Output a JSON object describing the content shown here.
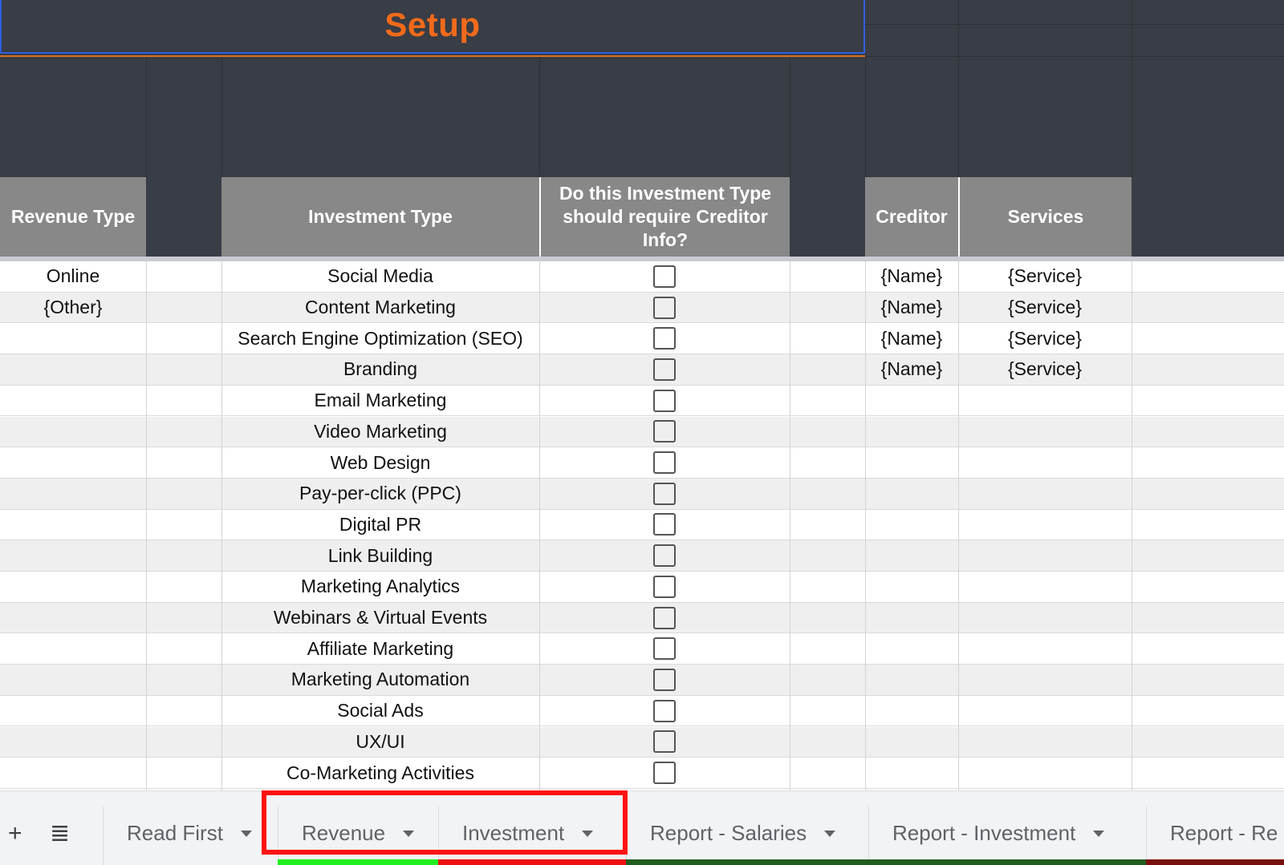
{
  "title": "Setup",
  "headers": {
    "revenue_type": "Revenue Type",
    "investment_type": "Investment Type",
    "creditor_question": "Do this Investment Type should require Creditor Info?",
    "creditor": "Creditor",
    "services": "Services"
  },
  "rows": [
    {
      "revenue": "Online",
      "investment": "Social Media",
      "checked": false,
      "creditor": "{Name}",
      "service": "{Service}"
    },
    {
      "revenue": "{Other}",
      "investment": "Content Marketing",
      "checked": false,
      "creditor": "{Name}",
      "service": "{Service}"
    },
    {
      "revenue": "",
      "investment": "Search Engine Optimization (SEO)",
      "checked": false,
      "creditor": "{Name}",
      "service": "{Service}"
    },
    {
      "revenue": "",
      "investment": "Branding",
      "checked": false,
      "creditor": "{Name}",
      "service": "{Service}"
    },
    {
      "revenue": "",
      "investment": "Email Marketing",
      "checked": false,
      "creditor": "",
      "service": ""
    },
    {
      "revenue": "",
      "investment": "Video Marketing",
      "checked": false,
      "creditor": "",
      "service": ""
    },
    {
      "revenue": "",
      "investment": "Web Design",
      "checked": false,
      "creditor": "",
      "service": ""
    },
    {
      "revenue": "",
      "investment": "Pay-per-click (PPC)",
      "checked": false,
      "creditor": "",
      "service": ""
    },
    {
      "revenue": "",
      "investment": "Digital PR",
      "checked": false,
      "creditor": "",
      "service": ""
    },
    {
      "revenue": "",
      "investment": "Link Building",
      "checked": false,
      "creditor": "",
      "service": ""
    },
    {
      "revenue": "",
      "investment": "Marketing Analytics",
      "checked": false,
      "creditor": "",
      "service": ""
    },
    {
      "revenue": "",
      "investment": "Webinars & Virtual Events",
      "checked": false,
      "creditor": "",
      "service": ""
    },
    {
      "revenue": "",
      "investment": "Affiliate Marketing",
      "checked": false,
      "creditor": "",
      "service": ""
    },
    {
      "revenue": "",
      "investment": "Marketing Automation",
      "checked": false,
      "creditor": "",
      "service": ""
    },
    {
      "revenue": "",
      "investment": "Social Ads",
      "checked": false,
      "creditor": "",
      "service": ""
    },
    {
      "revenue": "",
      "investment": "UX/UI",
      "checked": false,
      "creditor": "",
      "service": ""
    },
    {
      "revenue": "",
      "investment": "Co-Marketing Activities",
      "checked": false,
      "creditor": "",
      "service": ""
    }
  ],
  "tabs": {
    "add_icon": "+",
    "menu_icon": "≣",
    "items": [
      {
        "label": "Read First",
        "color": ""
      },
      {
        "label": "Revenue",
        "color": "#22ee22"
      },
      {
        "label": "Investment",
        "color": "#ee1111"
      },
      {
        "label": "Report - Salaries",
        "color": "#1f5e1f"
      },
      {
        "label": "Report - Investment",
        "color": "#1f5e1f"
      },
      {
        "label": "Report - Re",
        "color": "#7a0f0f"
      }
    ]
  },
  "colors": {
    "title": "#f26a1b",
    "highlight_box": "#ff1111",
    "header_bg": "#888888",
    "band_bg": "#393d45"
  }
}
